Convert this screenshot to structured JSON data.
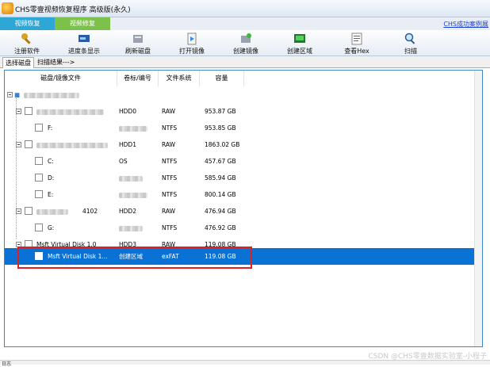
{
  "window": {
    "title": "CHS零壹视频恢复程序 高级版(永久)",
    "top_link": "CHS成功案例展"
  },
  "tabs": [
    {
      "label": "视频恢复"
    },
    {
      "label": "视频修复"
    }
  ],
  "toolbar": {
    "register": "注册软件",
    "progress": "进度条显示",
    "refresh": "刷新磁盘",
    "open_image": "打开镜像",
    "create_image": "创建镜像",
    "create_region": "创建区域",
    "hex": "查看Hex",
    "scan": "扫描"
  },
  "subtabs": {
    "select_disk": "选择磁盘",
    "scan_results": "扫描结果--->"
  },
  "table": {
    "headers": {
      "disk": "磁盘/镜像文件",
      "label": "卷标/编号",
      "fs": "文件系统",
      "capacity": "容量"
    },
    "rows": [
      {
        "name": "",
        "label": "HDD0",
        "fs": "RAW",
        "cap": "953.87 GB"
      },
      {
        "name": "F:",
        "label": "",
        "fs": "NTFS",
        "cap": "953.85 GB"
      },
      {
        "name": "",
        "label": "HDD1",
        "fs": "RAW",
        "cap": "1863.02 GB"
      },
      {
        "name": "C:",
        "label": "OS",
        "fs": "NTFS",
        "cap": "457.67 GB"
      },
      {
        "name": "D:",
        "label": "",
        "fs": "NTFS",
        "cap": "585.94 GB"
      },
      {
        "name": "E:",
        "label": "",
        "fs": "NTFS",
        "cap": "800.14 GB"
      },
      {
        "name": "4102",
        "label": "HDD2",
        "fs": "RAW",
        "cap": "476.94 GB"
      },
      {
        "name": "G:",
        "label": "",
        "fs": "NTFS",
        "cap": "476.92 GB"
      },
      {
        "name": "Msft    Virtual Disk    1.0",
        "label": "HDD3",
        "fs": "RAW",
        "cap": "119.08 GB"
      },
      {
        "name": "Msft    Virtual Disk    1...",
        "label": "创建区域",
        "fs": "exFAT",
        "cap": "119.08 GB"
      }
    ]
  },
  "status": {
    "text": "日志"
  },
  "watermark": "CSDN @CHS零壹数据实验室-小程子",
  "colors": {
    "selected": "#0a72d4",
    "tab1": "#2ea6d6",
    "tab2": "#7cc24a",
    "highlight_box": "#e02020"
  }
}
